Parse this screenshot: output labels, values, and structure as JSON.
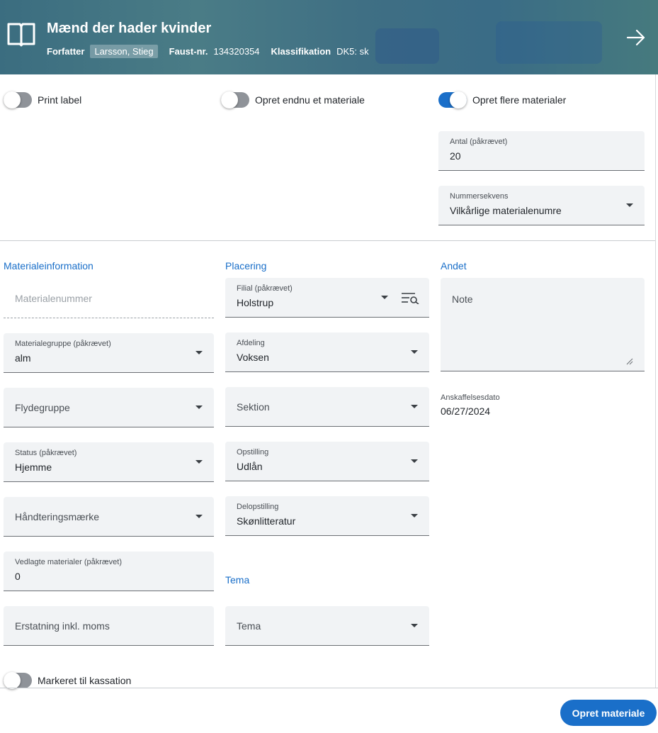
{
  "header": {
    "title": "Mænd der hader kvinder",
    "author_label": "Forfatter",
    "author_value": "Larsson, Stieg",
    "faust_label": "Faust-nr.",
    "faust_value": "134320354",
    "class_label": "Klassifikation",
    "class_value": "DK5: sk",
    "book_icon": "book-open-icon",
    "next_icon": "arrow-right-icon"
  },
  "toggles": {
    "print_label": {
      "label": "Print label",
      "on": false
    },
    "create_another": {
      "label": "Opret endnu et materiale",
      "on": false
    },
    "create_multiple": {
      "label": "Opret flere materialer",
      "on": true
    },
    "discard": {
      "label": "Markeret til kassation",
      "on": false
    }
  },
  "multiple": {
    "count_label": "Antal (påkrævet)",
    "count_value": "20",
    "sequence_label": "Nummersekvens",
    "sequence_value": "Vilkårlige materialenumre"
  },
  "sections": {
    "material_info": "Materialeinformation",
    "placement": "Placering",
    "other": "Andet",
    "theme": "Tema"
  },
  "material_info": {
    "material_number_placeholder": "Materialenummer",
    "material_group_label": "Materialegruppe (påkrævet)",
    "material_group_value": "alm",
    "float_group_placeholder": "Flydegruppe",
    "status_label": "Status (påkrævet)",
    "status_value": "Hjemme",
    "handling_mark_placeholder": "Håndteringsmærke",
    "attached_label": "Vedlagte materialer (påkrævet)",
    "attached_value": "0",
    "replacement_placeholder": "Erstatning inkl. moms"
  },
  "placement": {
    "branch_label": "Filial (påkrævet)",
    "branch_value": "Holstrup",
    "department_label": "Afdeling",
    "department_value": "Voksen",
    "section_placeholder": "Sektion",
    "shelving_label": "Opstilling",
    "shelving_value": "Udlån",
    "subshelving_label": "Delopstilling",
    "subshelving_value": "Skønlitteratur",
    "theme_placeholder": "Tema"
  },
  "other": {
    "note_placeholder": "Note",
    "acquisition_label": "Anskaffelsesdato",
    "acquisition_value": "06/27/2024"
  },
  "footer": {
    "submit_label": "Opret materiale"
  },
  "colors": {
    "accent": "#1a6fc9",
    "field_bg": "#f1f3f5"
  }
}
